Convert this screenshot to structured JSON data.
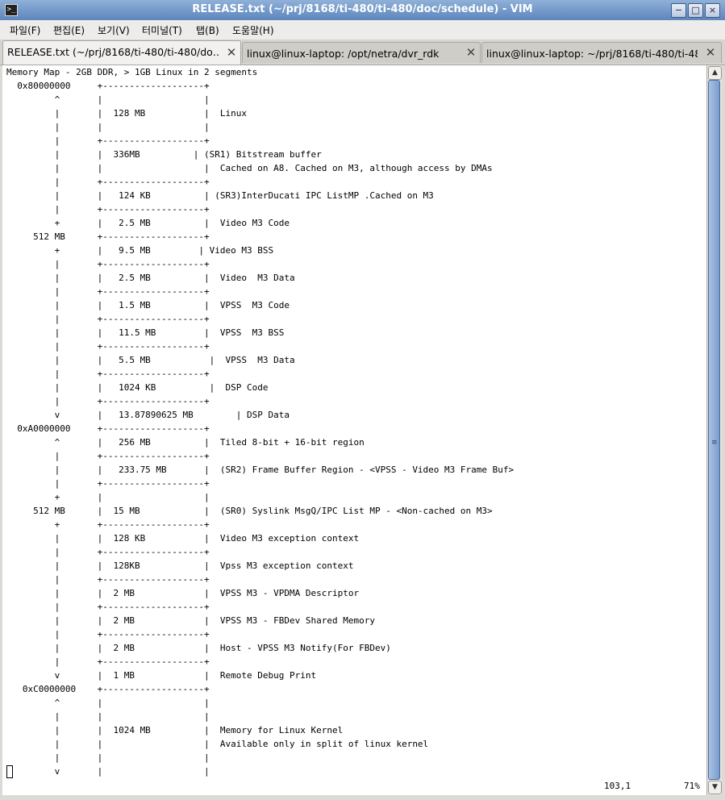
{
  "window": {
    "title": "RELEASE.txt (~/prj/8168/ti-480/ti-480/doc/schedule) - VIM",
    "icon": "terminal-icon",
    "controls": {
      "minimize": "−",
      "maximize": "□",
      "close": "×"
    }
  },
  "menu": [
    "파일(F)",
    "편집(E)",
    "보기(V)",
    "터미널(T)",
    "탭(B)",
    "도움말(H)"
  ],
  "tabs": [
    {
      "label": "RELEASE.txt (~/prj/8168/ti-480/ti-480/do…",
      "active": true
    },
    {
      "label": "linux@linux-laptop: /opt/netra/dvr_rdk",
      "active": false
    },
    {
      "label": "linux@linux-laptop: ~/prj/8168/ti-480/ti-48…",
      "active": false
    }
  ],
  "editor": {
    "lines": [
      "Memory Map - 2GB DDR, > 1GB Linux in 2 segments",
      "  0x80000000     +-------------------+",
      "         ^       |                   |",
      "         |       |  128 MB           |  Linux",
      "         |       |                   |",
      "         |       +-------------------+",
      "         |       |  336MB          | (SR1) Bitstream buffer",
      "         |       |                   |  Cached on A8. Cached on M3, although access by DMAs",
      "         |       +-------------------+",
      "         |       |   124 KB          | (SR3)InterDucati IPC ListMP .Cached on M3",
      "         |       +-------------------+",
      "         +       |   2.5 MB          |  Video M3 Code",
      "     512 MB      +-------------------+",
      "         +       |   9.5 MB         | Video M3 BSS",
      "         |       +-------------------+",
      "         |       |   2.5 MB          |  Video  M3 Data",
      "         |       +-------------------+",
      "         |       |   1.5 MB          |  VPSS  M3 Code",
      "         |       +-------------------+",
      "         |       |   11.5 MB         |  VPSS  M3 BSS",
      "         |       +-------------------+",
      "         |       |   5.5 MB           |  VPSS  M3 Data",
      "         |       +-------------------+",
      "         |       |   1024 KB          |  DSP Code",
      "         |       +-------------------+",
      "         v       |   13.87890625 MB        | DSP Data",
      "  0xA0000000     +-------------------+",
      "         ^       |   256 MB          |  Tiled 8-bit + 16-bit region",
      "         |       +-------------------+",
      "         |       |   233.75 MB       |  (SR2) Frame Buffer Region - <VPSS - Video M3 Frame Buf>",
      "         |       +-------------------+",
      "         +       |                   |",
      "     512 MB      |  15 MB            |  (SR0) Syslink MsgQ/IPC List MP - <Non-cached on M3>",
      "         +       +-------------------+",
      "         |       |  128 KB           |  Video M3 exception context",
      "         |       +-------------------+",
      "         |       |  128KB            |  Vpss M3 exception context",
      "         |       +-------------------+",
      "         |       |  2 MB             |  VPSS M3 - VPDMA Descriptor",
      "         |       +-------------------+",
      "         |       |  2 MB             |  VPSS M3 - FBDev Shared Memory",
      "         |       +-------------------+",
      "         |       |  2 MB             |  Host - VPSS M3 Notify(For FBDev)",
      "         |       +-------------------+",
      "         v       |  1 MB             |  Remote Debug Print",
      "   0xC0000000    +-------------------+",
      "         ^       |                   |",
      "         |       |                   |",
      "         |       |  1024 MB          |  Memory for Linux Kernel",
      "         |       |                   |  Available only in split of linux kernel",
      "         |       |                   |",
      "         v       |                   |"
    ]
  },
  "status": {
    "position": "103,1",
    "percent": "71%"
  },
  "scrollbar": {
    "up": "▲",
    "down": "▼",
    "grip": "≡"
  }
}
